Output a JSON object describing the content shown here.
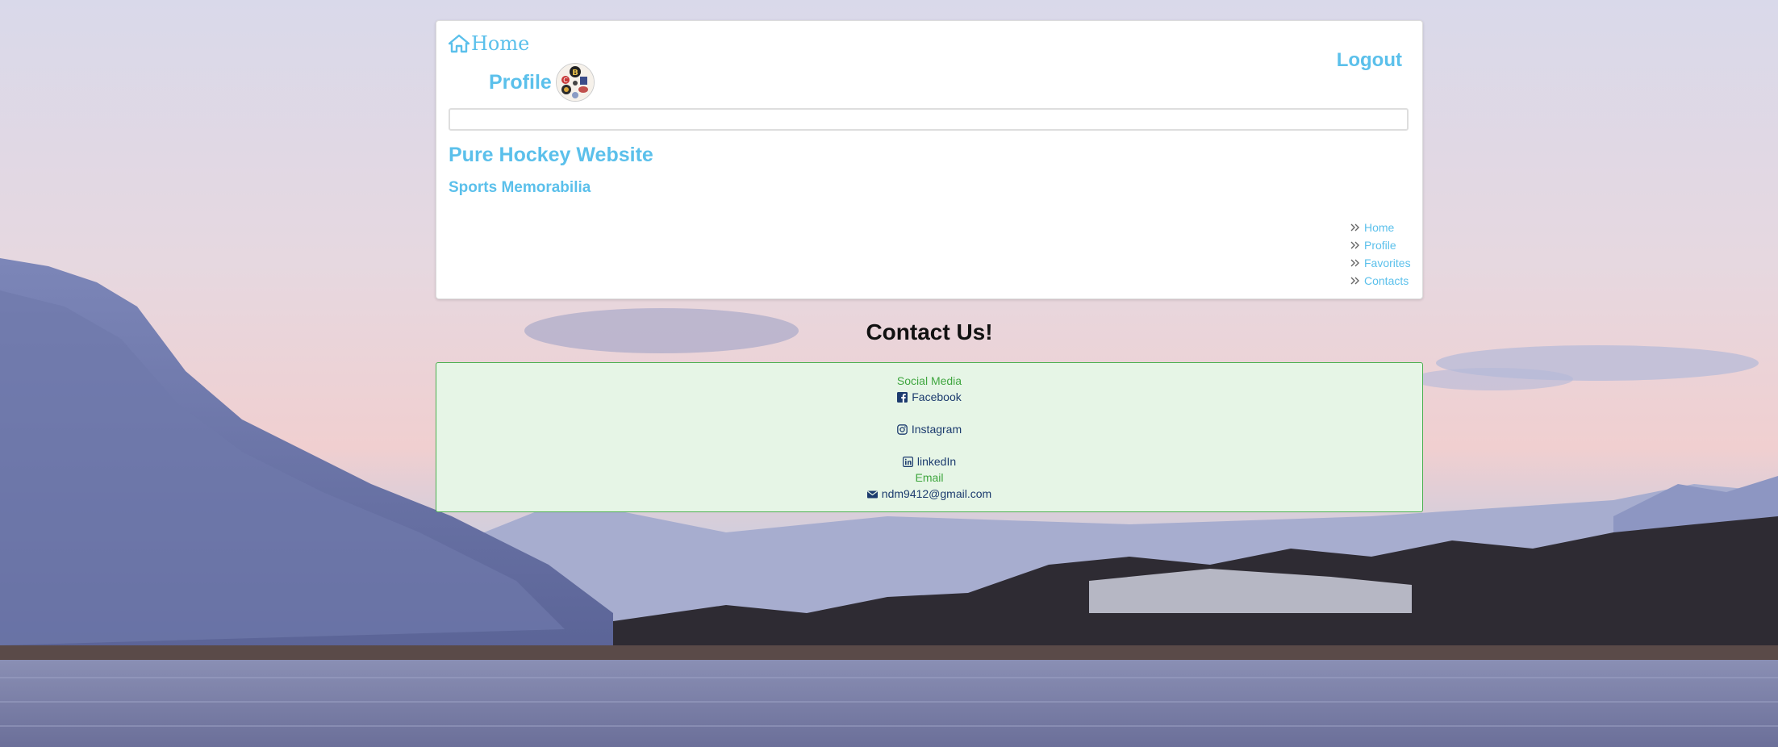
{
  "header": {
    "home_label": "Home",
    "profile_label": "Profile",
    "logout_label": "Logout",
    "search": {
      "value": "",
      "placeholder": ""
    },
    "title": "Pure Hockey Website",
    "subtitle": "Sports Memorabilia"
  },
  "side_nav": [
    {
      "label": "Home"
    },
    {
      "label": "Profile"
    },
    {
      "label": "Favorites"
    },
    {
      "label": "Contacts"
    }
  ],
  "contact": {
    "heading": "Contact Us!",
    "social_label": "Social Media",
    "facebook": "Facebook",
    "instagram": "Instagram",
    "linkedin": "linkedIn",
    "email_label": "Email",
    "email": "ndm9412@gmail.com"
  },
  "colors": {
    "link": "#5bc0eb",
    "contact_bg": "#e6f5e6",
    "contact_border": "#4caf50",
    "section_label": "#3fa63f",
    "contact_link": "#1c3b6e"
  },
  "icons": [
    "home-icon",
    "chevron-double-right-icon",
    "facebook-icon",
    "instagram-icon",
    "linkedin-icon",
    "envelope-icon"
  ]
}
